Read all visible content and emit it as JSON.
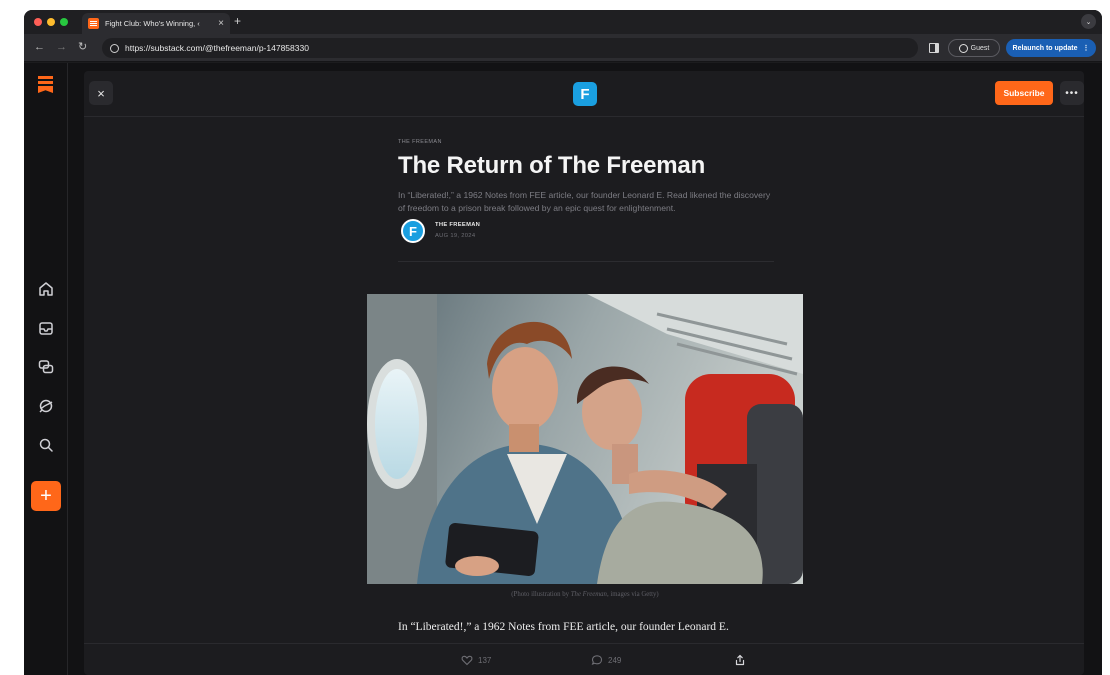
{
  "browser": {
    "tab_title": "Fight Club: Who's Winning, ‹",
    "tab_close": "×",
    "new_tab": "+",
    "url": "https://substack.com/@thefreeman/p-147858330",
    "guest_label": "Guest",
    "relaunch_label": "Relaunch to update",
    "relaunch_menu": "⋮",
    "back": "←",
    "forward": "→",
    "reload": "↻",
    "tab_menu": "⌄"
  },
  "reader": {
    "close": "×",
    "publication_initial": "F",
    "subscribe_label": "Subscribe",
    "more": "•••"
  },
  "article": {
    "kicker": "THE FREEMAN",
    "title": "The Return of The Freeman",
    "subtitle": "In “Liberated!,” a 1962 Notes from FEE article, our founder Leonard E. Read likened the discovery of freedom to a prison break followed by an epic quest for enlightenment.",
    "author_initial": "F",
    "author": "THE FREEMAN",
    "date": "AUG 19, 2024",
    "caption_prefix": "(Photo illustration by ",
    "caption_source": "The Freeman",
    "caption_suffix": ", images via Getty)",
    "body_first_line": "In “Liberated!,” a 1962 Notes from FEE article, our founder Leonard E."
  },
  "actions": {
    "likes": "137",
    "comments": "249"
  },
  "colors": {
    "accent": "#ff6719",
    "publication_blue": "#1a9fe0",
    "relaunch_blue": "#1a5fb4"
  },
  "left_nav": {
    "icons": [
      "home-icon",
      "inbox-icon",
      "chat-icon",
      "explore-icon",
      "search-icon"
    ],
    "create": "+"
  }
}
